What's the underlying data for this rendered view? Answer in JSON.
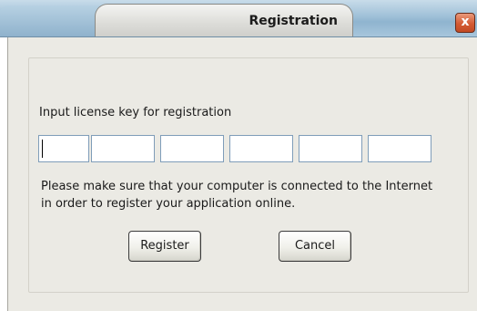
{
  "window": {
    "title": "Registration",
    "close_glyph": "x"
  },
  "form": {
    "prompt": "Input license key for registration",
    "key_fields": [
      "",
      "",
      "",
      "",
      "",
      ""
    ],
    "notice": "Please make sure that your computer is connected to the Internet in order to register your application online.",
    "register_label": "Register",
    "cancel_label": "Cancel"
  },
  "colors": {
    "titlebar": "#9fc0d8",
    "client_bg": "#ebeae4",
    "close_button": "#d45a33",
    "input_border": "#7f9db9"
  },
  "icons": {
    "close": "close-icon"
  }
}
